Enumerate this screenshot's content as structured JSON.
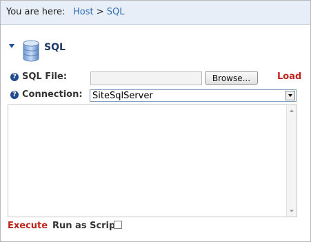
{
  "breadcrumb": {
    "label": "You are here:",
    "items": [
      "Host",
      "SQL"
    ],
    "separator": ">"
  },
  "section": {
    "title": "SQL"
  },
  "sql_file": {
    "label": "SQL File:",
    "value": "",
    "browse_label": "Browse...",
    "load_label": "Load"
  },
  "connection": {
    "label": "Connection:",
    "selected": "SiteSqlServer"
  },
  "editor": {
    "value": ""
  },
  "actions": {
    "execute_label": "Execute",
    "run_as_script_label": "Run as Script",
    "run_as_script_checked": false
  },
  "icons": {
    "help": "question-mark-icon",
    "section": "database-icon",
    "collapse": "caret-down-icon"
  },
  "colors": {
    "link": "#2f6fb5",
    "action_red": "#c0221b",
    "breadcrumb_bg": "#e8eef7",
    "title_blue": "#1f3a66"
  }
}
